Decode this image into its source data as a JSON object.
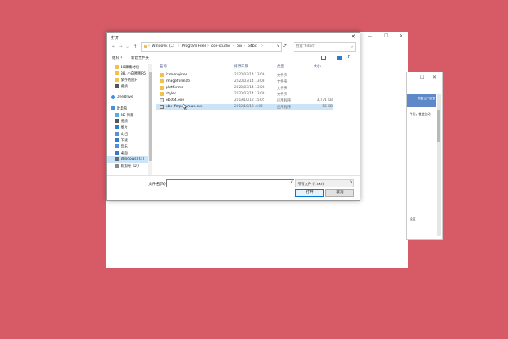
{
  "bg_window": {
    "minimize": "—",
    "maximize": "☐",
    "close": "✕"
  },
  "side_window": {
    "maximize": "☐",
    "close": "✕",
    "banner": "恢复出厂设置",
    "text1": "件后，都会自动",
    "text2": "设置"
  },
  "dialog": {
    "title": "打开",
    "close": "✕",
    "nav": {
      "back": "←",
      "forward": "→",
      "down": "∨",
      "up": "↑"
    },
    "address": {
      "segments": [
        "Windows (C:)",
        "Program Files",
        "obs-studio",
        "bin",
        "64bit"
      ],
      "separator": "›"
    },
    "search_placeholder": "搜索\"64bit\"",
    "toolbar": {
      "organize": "组织 ▾",
      "new_folder": "新建文件夹"
    },
    "nav_items": [
      {
        "label": "10课素材包",
        "icon": "folder"
      },
      {
        "label": "88. 小白圈图R6",
        "icon": "folder"
      },
      {
        "label": "保存的图片",
        "icon": "folder"
      },
      {
        "label": "视频",
        "icon": "video"
      },
      {
        "label": "OneDrive",
        "icon": "cloud"
      },
      {
        "label": "此电脑",
        "icon": "pc"
      },
      {
        "label": "3D 对象",
        "icon": "obj"
      },
      {
        "label": "视频",
        "icon": "video"
      },
      {
        "label": "图片",
        "icon": "img"
      },
      {
        "label": "文档",
        "icon": "doc"
      },
      {
        "label": "下载",
        "icon": "dl"
      },
      {
        "label": "音乐",
        "icon": "music"
      },
      {
        "label": "桌面",
        "icon": "desk"
      },
      {
        "label": "Windows (C:)",
        "icon": "win"
      },
      {
        "label": "新加卷 (D:)",
        "icon": "drv"
      }
    ],
    "columns": {
      "name": "名称",
      "date": "修改日期",
      "type": "类型",
      "size": "大小"
    },
    "files": [
      {
        "name": "iconengines",
        "date": "2020/03/14 13:08",
        "type": "文件夹",
        "size": "",
        "icon": "folder"
      },
      {
        "name": "imageformats",
        "date": "2020/03/14 13:08",
        "type": "文件夹",
        "size": "",
        "icon": "folder"
      },
      {
        "name": "platforms",
        "date": "2020/03/14 13:08",
        "type": "文件夹",
        "size": "",
        "icon": "folder"
      },
      {
        "name": "styles",
        "date": "2020/03/14 13:08",
        "type": "文件夹",
        "size": "",
        "icon": "folder"
      },
      {
        "name": "obs64.exe",
        "date": "2019/10/12 15:05",
        "type": "应用程序",
        "size": "3,271 KB",
        "icon": "exe"
      },
      {
        "name": "obs-ffmpeg-mux.exe",
        "date": "2019/10/12 4:06",
        "type": "应用程序",
        "size": "56 KB",
        "icon": "exe2"
      }
    ],
    "filename_label": "文件名(N):",
    "filename_value": "",
    "filter": "所有文件 (*.exe)",
    "open_button": "打开",
    "cancel_button": "取消",
    "dropdown": "∨"
  }
}
